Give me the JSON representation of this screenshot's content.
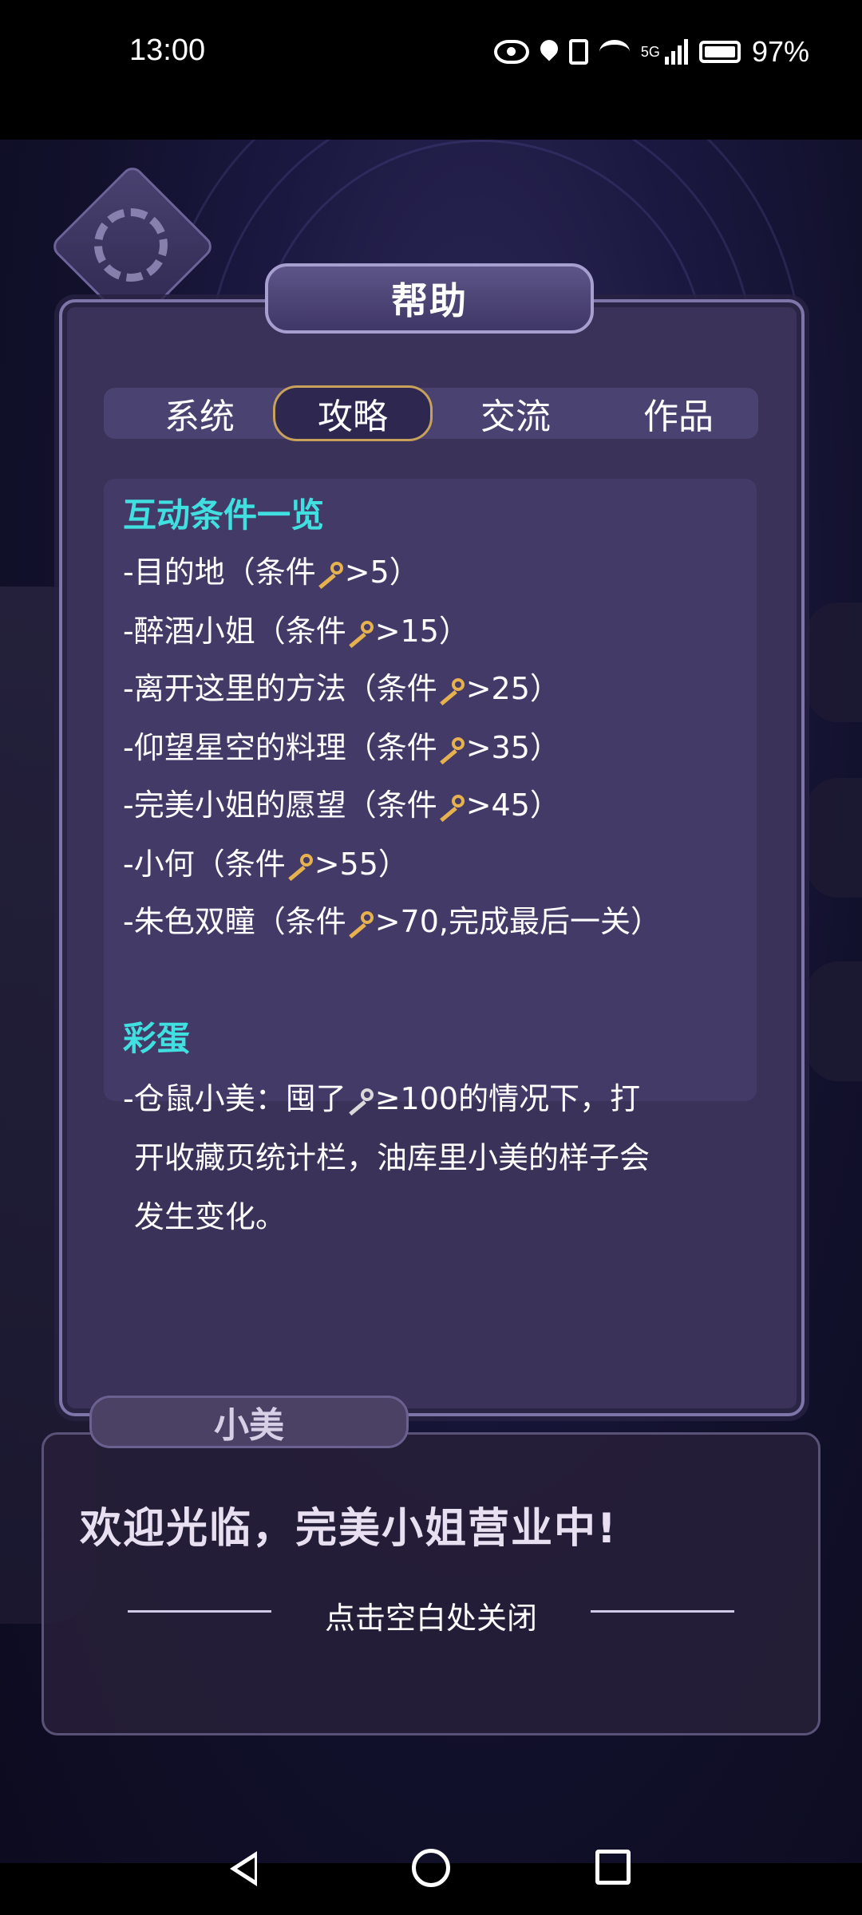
{
  "status_bar": {
    "time": "13:00",
    "network": "5G",
    "battery": "97%"
  },
  "dialog_title": "帮助",
  "tabs": [
    "系统",
    "攻略",
    "交流",
    "作品"
  ],
  "active_tab": "攻略",
  "section1": {
    "heading": "互动条件一览",
    "items": [
      {
        "prefix": "-目的地（条件",
        "suffix": ">5）"
      },
      {
        "prefix": "-醉酒小姐（条件",
        "suffix": ">15）"
      },
      {
        "prefix": "-离开这里的方法（条件",
        "suffix": ">25）"
      },
      {
        "prefix": "-仰望星空的料理（条件",
        "suffix": ">35）"
      },
      {
        "prefix": "-完美小姐的愿望（条件",
        "suffix": ">45）"
      },
      {
        "prefix": "-小何（条件",
        "suffix": ">55）"
      },
      {
        "prefix": "-朱色双瞳（条件",
        "suffix": ">70,完成最后一关）"
      }
    ]
  },
  "section2": {
    "heading": "彩蛋",
    "line1_prefix": "-仓鼠小美：囤了",
    "line1_suffix": "≥100的情况下，打",
    "line2": "开收藏页统计栏，油库里小美的样子会",
    "line3": "发生变化。"
  },
  "speaker_name": "小美",
  "dialogue": "欢迎光临，完美小姐营业中!",
  "close_hint": "点击空白处关闭"
}
